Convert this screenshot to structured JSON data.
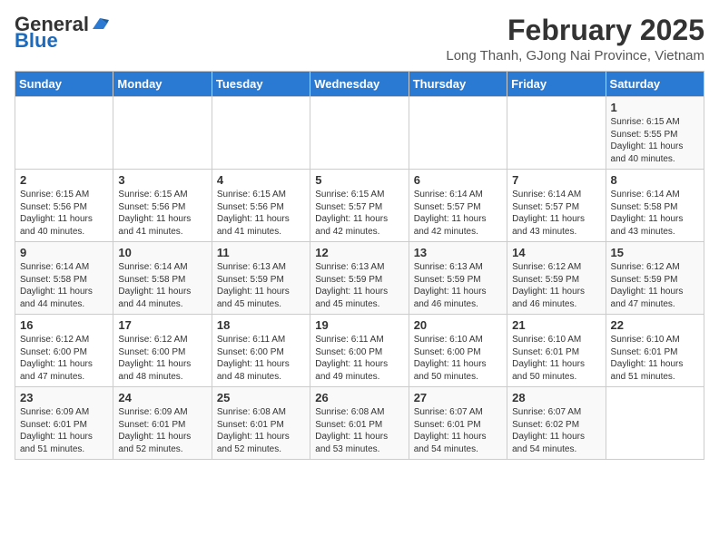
{
  "header": {
    "logo_general": "General",
    "logo_blue": "Blue",
    "month_year": "February 2025",
    "location": "Long Thanh, GJong Nai Province, Vietnam"
  },
  "weekdays": [
    "Sunday",
    "Monday",
    "Tuesday",
    "Wednesday",
    "Thursday",
    "Friday",
    "Saturday"
  ],
  "weeks": [
    [
      {
        "day": "",
        "info": ""
      },
      {
        "day": "",
        "info": ""
      },
      {
        "day": "",
        "info": ""
      },
      {
        "day": "",
        "info": ""
      },
      {
        "day": "",
        "info": ""
      },
      {
        "day": "",
        "info": ""
      },
      {
        "day": "1",
        "info": "Sunrise: 6:15 AM\nSunset: 5:55 PM\nDaylight: 11 hours\nand 40 minutes."
      }
    ],
    [
      {
        "day": "2",
        "info": "Sunrise: 6:15 AM\nSunset: 5:56 PM\nDaylight: 11 hours\nand 40 minutes."
      },
      {
        "day": "3",
        "info": "Sunrise: 6:15 AM\nSunset: 5:56 PM\nDaylight: 11 hours\nand 41 minutes."
      },
      {
        "day": "4",
        "info": "Sunrise: 6:15 AM\nSunset: 5:56 PM\nDaylight: 11 hours\nand 41 minutes."
      },
      {
        "day": "5",
        "info": "Sunrise: 6:15 AM\nSunset: 5:57 PM\nDaylight: 11 hours\nand 42 minutes."
      },
      {
        "day": "6",
        "info": "Sunrise: 6:14 AM\nSunset: 5:57 PM\nDaylight: 11 hours\nand 42 minutes."
      },
      {
        "day": "7",
        "info": "Sunrise: 6:14 AM\nSunset: 5:57 PM\nDaylight: 11 hours\nand 43 minutes."
      },
      {
        "day": "8",
        "info": "Sunrise: 6:14 AM\nSunset: 5:58 PM\nDaylight: 11 hours\nand 43 minutes."
      }
    ],
    [
      {
        "day": "9",
        "info": "Sunrise: 6:14 AM\nSunset: 5:58 PM\nDaylight: 11 hours\nand 44 minutes."
      },
      {
        "day": "10",
        "info": "Sunrise: 6:14 AM\nSunset: 5:58 PM\nDaylight: 11 hours\nand 44 minutes."
      },
      {
        "day": "11",
        "info": "Sunrise: 6:13 AM\nSunset: 5:59 PM\nDaylight: 11 hours\nand 45 minutes."
      },
      {
        "day": "12",
        "info": "Sunrise: 6:13 AM\nSunset: 5:59 PM\nDaylight: 11 hours\nand 45 minutes."
      },
      {
        "day": "13",
        "info": "Sunrise: 6:13 AM\nSunset: 5:59 PM\nDaylight: 11 hours\nand 46 minutes."
      },
      {
        "day": "14",
        "info": "Sunrise: 6:12 AM\nSunset: 5:59 PM\nDaylight: 11 hours\nand 46 minutes."
      },
      {
        "day": "15",
        "info": "Sunrise: 6:12 AM\nSunset: 5:59 PM\nDaylight: 11 hours\nand 47 minutes."
      }
    ],
    [
      {
        "day": "16",
        "info": "Sunrise: 6:12 AM\nSunset: 6:00 PM\nDaylight: 11 hours\nand 47 minutes."
      },
      {
        "day": "17",
        "info": "Sunrise: 6:12 AM\nSunset: 6:00 PM\nDaylight: 11 hours\nand 48 minutes."
      },
      {
        "day": "18",
        "info": "Sunrise: 6:11 AM\nSunset: 6:00 PM\nDaylight: 11 hours\nand 48 minutes."
      },
      {
        "day": "19",
        "info": "Sunrise: 6:11 AM\nSunset: 6:00 PM\nDaylight: 11 hours\nand 49 minutes."
      },
      {
        "day": "20",
        "info": "Sunrise: 6:10 AM\nSunset: 6:00 PM\nDaylight: 11 hours\nand 50 minutes."
      },
      {
        "day": "21",
        "info": "Sunrise: 6:10 AM\nSunset: 6:01 PM\nDaylight: 11 hours\nand 50 minutes."
      },
      {
        "day": "22",
        "info": "Sunrise: 6:10 AM\nSunset: 6:01 PM\nDaylight: 11 hours\nand 51 minutes."
      }
    ],
    [
      {
        "day": "23",
        "info": "Sunrise: 6:09 AM\nSunset: 6:01 PM\nDaylight: 11 hours\nand 51 minutes."
      },
      {
        "day": "24",
        "info": "Sunrise: 6:09 AM\nSunset: 6:01 PM\nDaylight: 11 hours\nand 52 minutes."
      },
      {
        "day": "25",
        "info": "Sunrise: 6:08 AM\nSunset: 6:01 PM\nDaylight: 11 hours\nand 52 minutes."
      },
      {
        "day": "26",
        "info": "Sunrise: 6:08 AM\nSunset: 6:01 PM\nDaylight: 11 hours\nand 53 minutes."
      },
      {
        "day": "27",
        "info": "Sunrise: 6:07 AM\nSunset: 6:01 PM\nDaylight: 11 hours\nand 54 minutes."
      },
      {
        "day": "28",
        "info": "Sunrise: 6:07 AM\nSunset: 6:02 PM\nDaylight: 11 hours\nand 54 minutes."
      },
      {
        "day": "",
        "info": ""
      }
    ]
  ]
}
